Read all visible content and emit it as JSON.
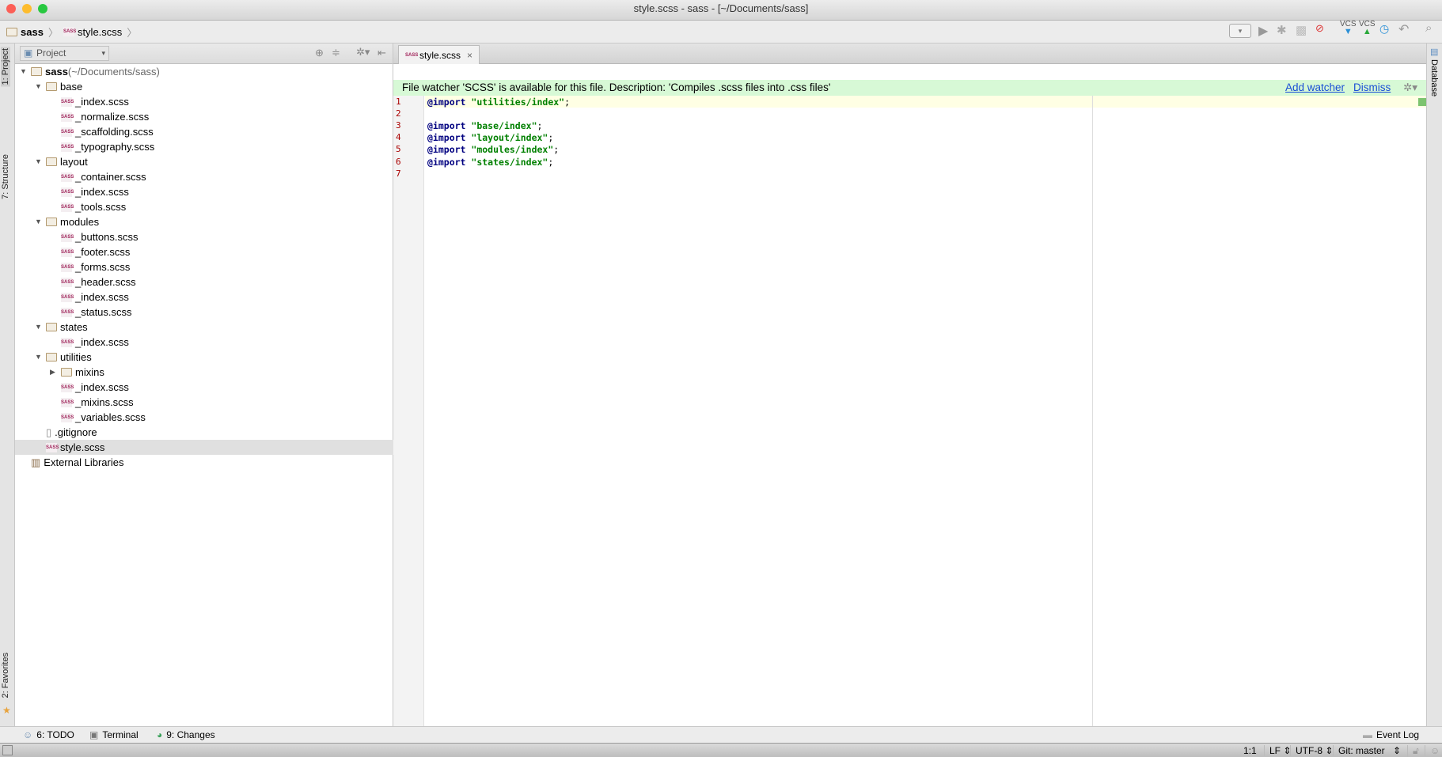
{
  "window": {
    "title": "style.scss - sass - [~/Documents/sass]"
  },
  "breadcrumb": [
    "sass",
    "style.scss"
  ],
  "toolbar": {
    "icons": [
      "run-config-dropdown",
      "run-icon",
      "debug-icon",
      "coverage-icon",
      "stop-icon",
      "vcs-update-icon",
      "vcs-commit-icon",
      "history-icon",
      "revert-icon",
      "search-icon"
    ],
    "vcs_label": "VCS"
  },
  "left_strip": {
    "project": "1: Project",
    "structure": "7: Structure",
    "favorites": "2: Favorites"
  },
  "right_strip": {
    "database": "Database"
  },
  "project": {
    "view_selector": "Project",
    "tree": [
      {
        "label": "sass",
        "suffix": " (~/Documents/sass)",
        "type": "folder",
        "depth": 0,
        "expanded": true,
        "bold": true
      },
      {
        "label": "base",
        "type": "folder",
        "depth": 1,
        "expanded": true
      },
      {
        "label": "_index.scss",
        "type": "sass",
        "depth": 2
      },
      {
        "label": "_normalize.scss",
        "type": "sass",
        "depth": 2
      },
      {
        "label": "_scaffolding.scss",
        "type": "sass",
        "depth": 2
      },
      {
        "label": "_typography.scss",
        "type": "sass",
        "depth": 2
      },
      {
        "label": "layout",
        "type": "folder",
        "depth": 1,
        "expanded": true
      },
      {
        "label": "_container.scss",
        "type": "sass",
        "depth": 2
      },
      {
        "label": "_index.scss",
        "type": "sass",
        "depth": 2
      },
      {
        "label": "_tools.scss",
        "type": "sass",
        "depth": 2
      },
      {
        "label": "modules",
        "type": "folder",
        "depth": 1,
        "expanded": true
      },
      {
        "label": "_buttons.scss",
        "type": "sass",
        "depth": 2
      },
      {
        "label": "_footer.scss",
        "type": "sass",
        "depth": 2
      },
      {
        "label": "_forms.scss",
        "type": "sass",
        "depth": 2
      },
      {
        "label": "_header.scss",
        "type": "sass",
        "depth": 2
      },
      {
        "label": "_index.scss",
        "type": "sass",
        "depth": 2
      },
      {
        "label": "_status.scss",
        "type": "sass",
        "depth": 2
      },
      {
        "label": "states",
        "type": "folder",
        "depth": 1,
        "expanded": true
      },
      {
        "label": "_index.scss",
        "type": "sass",
        "depth": 2
      },
      {
        "label": "utilities",
        "type": "folder",
        "depth": 1,
        "expanded": true
      },
      {
        "label": "mixins",
        "type": "folder",
        "depth": 2,
        "expanded": false
      },
      {
        "label": "_index.scss",
        "type": "sass",
        "depth": 2
      },
      {
        "label": "_mixins.scss",
        "type": "sass",
        "depth": 2
      },
      {
        "label": "_variables.scss",
        "type": "sass",
        "depth": 2
      },
      {
        "label": ".gitignore",
        "type": "file",
        "depth": 1
      },
      {
        "label": "style.scss",
        "type": "sass",
        "depth": 1,
        "selected": true
      },
      {
        "label": "External Libraries",
        "type": "lib",
        "depth": 0
      }
    ]
  },
  "editor": {
    "tab": "style.scss",
    "notification": {
      "text": "File watcher 'SCSS' is available for this file. Description: 'Compiles .scss files into .css files'",
      "add": "Add watcher",
      "dismiss": "Dismiss"
    },
    "lines": [
      {
        "n": "1",
        "kw": "@import",
        "str": "\"utilities/index\"",
        "end": ";"
      },
      {
        "n": "2",
        "kw": "",
        "str": "",
        "end": ""
      },
      {
        "n": "3",
        "kw": "@import",
        "str": "\"base/index\"",
        "end": ";"
      },
      {
        "n": "4",
        "kw": "@import",
        "str": "\"layout/index\"",
        "end": ";"
      },
      {
        "n": "5",
        "kw": "@import",
        "str": "\"modules/index\"",
        "end": ";"
      },
      {
        "n": "6",
        "kw": "@import",
        "str": "\"states/index\"",
        "end": ";"
      },
      {
        "n": "7",
        "kw": "",
        "str": "",
        "end": ""
      }
    ]
  },
  "bottom_tools": {
    "todo": "6: TODO",
    "terminal": "Terminal",
    "changes": "9: Changes",
    "event_log": "Event Log"
  },
  "status": {
    "position": "1:1",
    "line_sep": "LF",
    "encoding": "UTF-8",
    "vcs": "Git: master"
  },
  "colors": {
    "notification_bg": "#d7f9d6",
    "link": "#1a4fd6",
    "keyword": "#000080",
    "string": "#008000",
    "selection": "#e0e0e0"
  }
}
